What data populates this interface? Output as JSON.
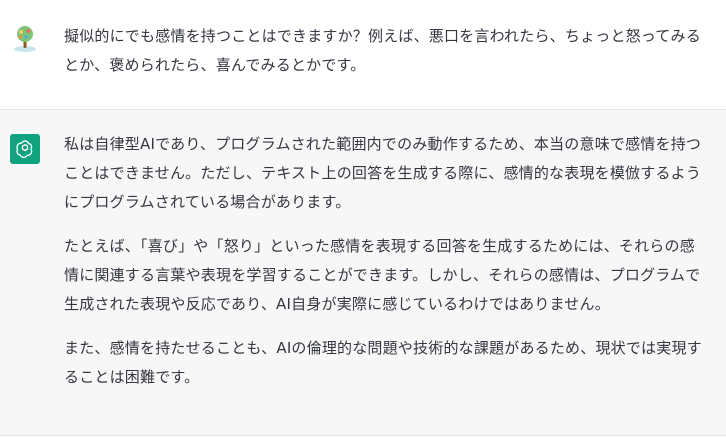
{
  "user_message": {
    "text": "擬似的にでも感情を持つことはできますか？例えば、悪口を言われたら、ちょっと怒ってみるとか、褒められたら、喜んでみるとかです。"
  },
  "assistant_message": {
    "paragraphs": [
      "私は自律型AIであり、プログラムされた範囲内でのみ動作するため、本当の意味で感情を持つことはできません。ただし、テキスト上の回答を生成する際に、感情的な表現を模倣するようにプログラムされている場合があります。",
      "たとえば、「喜び」や「怒り」といった感情を表現する回答を生成するためには、それらの感情に関連する言葉や表現を学習することができます。しかし、それらの感情は、プログラムで生成された表現や反応であり、AI自身が実際に感じているわけではありません。",
      "また、感情を持たせることも、AIの倫理的な問題や技術的な課題があるため、現状では実現することは困難です。"
    ]
  },
  "colors": {
    "assistant_avatar_bg": "#10a37f",
    "assistant_row_bg": "#f7f7f8",
    "text": "#353740"
  },
  "icons": {
    "user_avatar": "user-avatar-icon",
    "assistant_avatar": "openai-logo-icon"
  }
}
